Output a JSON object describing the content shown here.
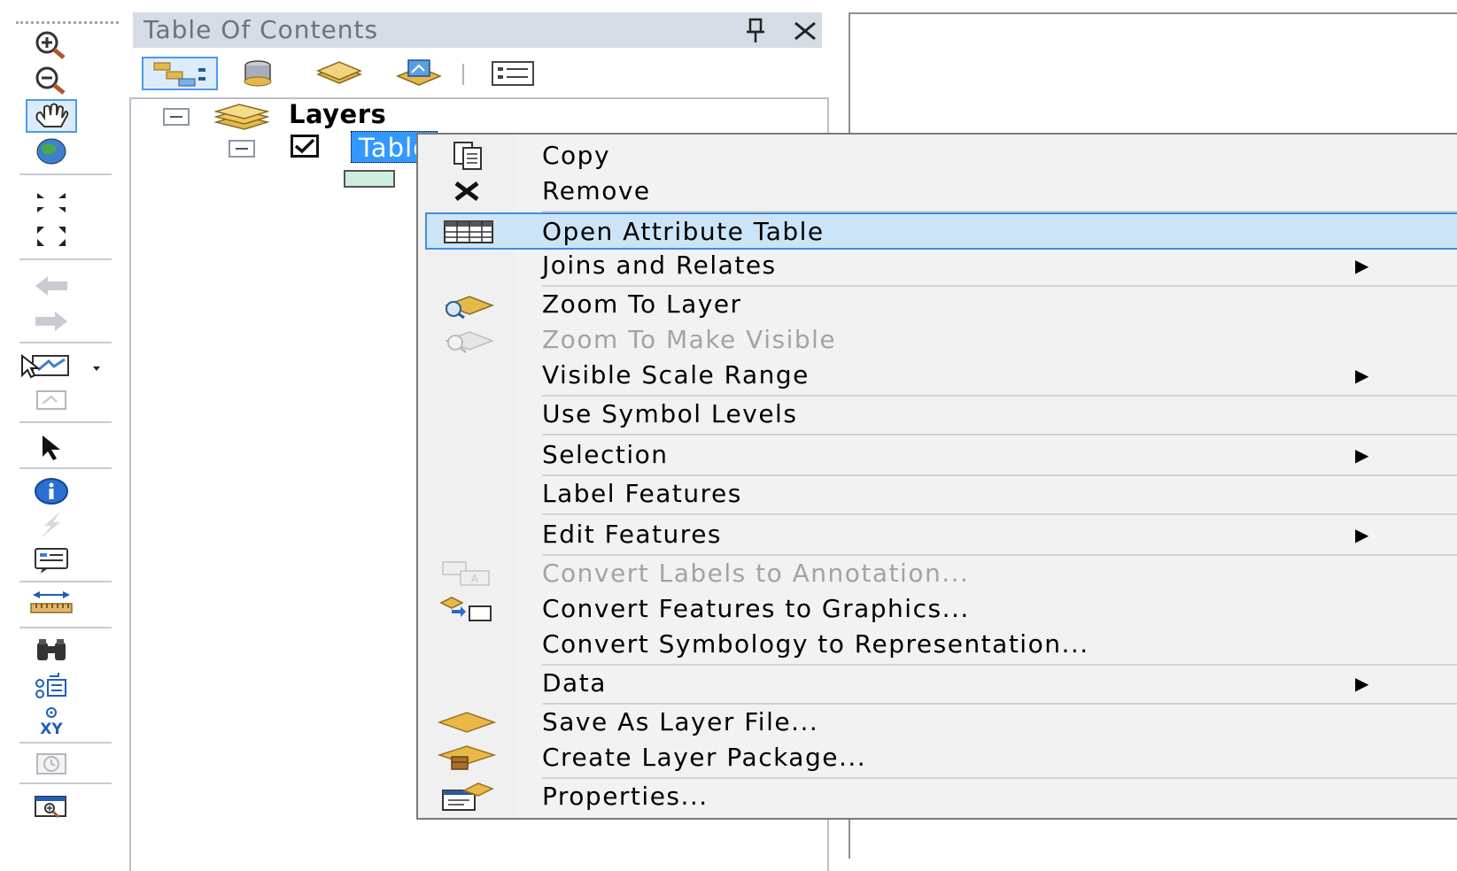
{
  "toc": {
    "title": "Table Of Contents",
    "pin_icon": "pin-icon",
    "close_icon": "close-icon"
  },
  "tree": {
    "root_label": "Layers",
    "layer_label": "Table",
    "layer_checked": true
  },
  "context_menu": {
    "items": [
      {
        "label": "Copy",
        "icon": "copy-icon",
        "enabled": true,
        "submenu": false
      },
      {
        "label": "Remove",
        "icon": "remove-icon",
        "enabled": true,
        "submenu": false
      },
      {
        "label": "Open Attribute Table",
        "icon": "table-icon",
        "enabled": true,
        "submenu": false,
        "highlighted": true
      },
      {
        "label": "Joins and Relates",
        "icon": "",
        "enabled": true,
        "submenu": true
      },
      {
        "label": "Zoom To Layer",
        "icon": "zoom-layer-icon",
        "enabled": true,
        "submenu": false
      },
      {
        "label": "Zoom To Make Visible",
        "icon": "zoom-visible-icon",
        "enabled": false,
        "submenu": false
      },
      {
        "label": "Visible Scale Range",
        "icon": "",
        "enabled": true,
        "submenu": true
      },
      {
        "label": "Use Symbol Levels",
        "icon": "",
        "enabled": true,
        "submenu": false
      },
      {
        "label": "Selection",
        "icon": "",
        "enabled": true,
        "submenu": true
      },
      {
        "label": "Label Features",
        "icon": "",
        "enabled": true,
        "submenu": false
      },
      {
        "label": "Edit Features",
        "icon": "",
        "enabled": true,
        "submenu": true
      },
      {
        "label": "Convert Labels to Annotation...",
        "icon": "convert-labels-icon",
        "enabled": false,
        "submenu": false
      },
      {
        "label": "Convert Features to Graphics...",
        "icon": "convert-graphics-icon",
        "enabled": true,
        "submenu": false
      },
      {
        "label": "Convert Symbology to Representation...",
        "icon": "",
        "enabled": true,
        "submenu": false
      },
      {
        "label": "Data",
        "icon": "",
        "enabled": true,
        "submenu": true
      },
      {
        "label": "Save As Layer File...",
        "icon": "layer-file-icon",
        "enabled": true,
        "submenu": false
      },
      {
        "label": "Create Layer Package...",
        "icon": "layer-package-icon",
        "enabled": true,
        "submenu": false
      },
      {
        "label": "Properties...",
        "icon": "properties-icon",
        "enabled": true,
        "submenu": false
      }
    ],
    "submenu_arrow": "▶"
  },
  "colors": {
    "selection_blue": "#3399ff",
    "menu_highlight": "#cce4f7",
    "disabled_text": "#a3a3a3"
  }
}
